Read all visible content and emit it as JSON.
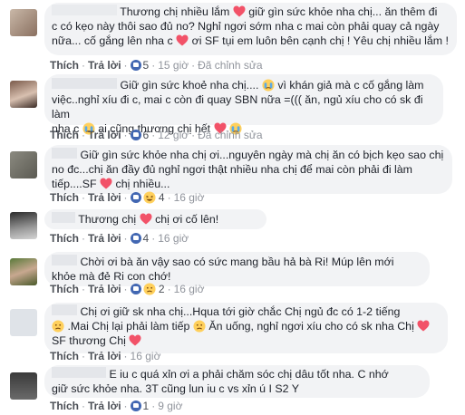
{
  "actions": {
    "like": "Thích",
    "reply": "Trả lời",
    "edited": "Đã chỉnh sửa"
  },
  "colors": {
    "heart": "#f25268",
    "like": "#4267b2",
    "bubble": "#f2f3f5",
    "link": "#4b4f56",
    "muted": "#90949c",
    "emoji_face": "#ffd05c"
  },
  "comments": [
    {
      "line1a": "Thương chị nhiều lắm",
      "line1b": "giữ gìn sức khỏe nha chị... ăn thêm đi",
      "line2": "c có kẹo này thôi sao đủ no? Nghỉ ngơi sớm nha c mai còn phải quay cả ngày",
      "line3a": "nữa... cố gắng lên nha c",
      "line3b": "ơi SF tụi em luôn bên cạnh chị ! Yêu chị nhiều lắm !",
      "count": "5",
      "time": "15 giờ",
      "edited": true
    },
    {
      "line1a": "Giữ gìn sức khoẻ nha chị....",
      "line1b": "vì khán giả mà c cố gắng làm",
      "line2": "việc..nghỉ xíu đi c, mai c còn đi quay SBN nữa =((( ăn, ngủ xíu cho có sk đi làm",
      "line3a": "nha c",
      "line3b": "ai cũng thương chị hết",
      "count": "6",
      "time": "12 giờ",
      "edited": true
    },
    {
      "line1": "Giữ gìn sức khỏe nha chị ơi...nguyên ngày mà chị ăn có bịch kẹo sao chị",
      "line2": "no đc...chị ăn đầy đủ nghỉ ngơi thật nhiều nha chị để mai còn phải đi làm",
      "line3a": "tiếp....SF",
      "line3b": "chị nhiều...",
      "count": "4",
      "time": "16 giờ"
    },
    {
      "line1a": "Thương chị",
      "line1b": "chị ơi cố lên!",
      "count": "4",
      "time": "16 giờ"
    },
    {
      "line1": "Chời ơi bà ăn vậy sao có sức mang bầu hả bà Ri! Múp lên mới",
      "line2": "khỏe mà đẻ Ri con chớ!",
      "count": "2",
      "time": "16 giờ"
    },
    {
      "line1": "Chị ơi giữ sk nha chị...Hqua tới giờ chắc Chị ngủ đc có 1-2 tiếng",
      "line2a": ".Mai Chị lại phải làm tiếp",
      "line2b": "Ăn uống, nghỉ ngơi xíu cho có sk nha Chị",
      "line3": "SF thương Chị",
      "time": "16 giờ"
    },
    {
      "line1": "E iu c quá xỉn ơi a phải chăm sóc chị dâu tốt nha. C nhớ",
      "line2": "giữ sức khỏe nha. 3T cũng lun iu c vs xỉn ú I S2 Y",
      "count": "1",
      "time": "9 giờ"
    }
  ]
}
